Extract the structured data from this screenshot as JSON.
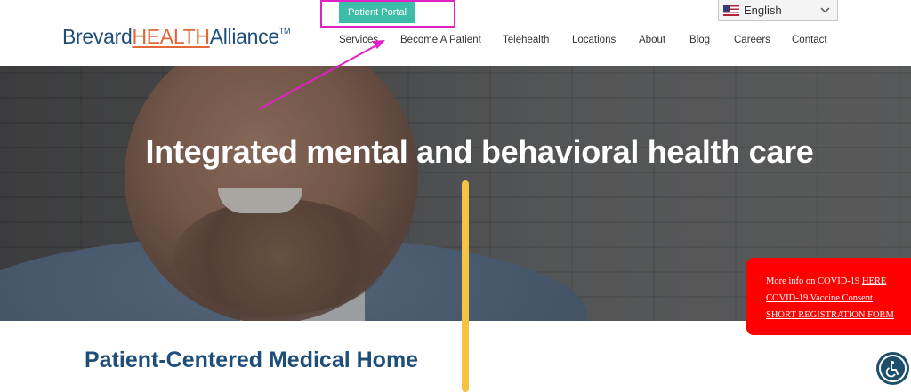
{
  "header": {
    "logo": {
      "part1": "Brevard",
      "part2": "HEALTH",
      "part3": "Alliance",
      "tm": "TM"
    },
    "portal_button": "Patient Portal",
    "language": {
      "selected": "English",
      "icon": "us-flag-icon"
    },
    "nav": [
      "Services",
      "Become A Patient",
      "Telehealth",
      "Locations",
      "About",
      "Blog",
      "Careers",
      "Contact"
    ]
  },
  "hero": {
    "headline": "Integrated mental and behavioral health care"
  },
  "covid_notice": {
    "line1_prefix": "More info on COVID-19 ",
    "line1_link": "HERE",
    "line2_link": "COVID-19 Vaccine Consent",
    "line3_link": "SHORT REGISTRATION FORM",
    "color": "#ff0000"
  },
  "section": {
    "title": "Patient-Centered Medical Home"
  },
  "colors": {
    "brand_blue": "#1f4e79",
    "brand_orange": "#e2673a",
    "portal_green": "#3dbda7",
    "annotation_magenta": "#e021c4",
    "annotation_yellow": "#f5c242"
  }
}
